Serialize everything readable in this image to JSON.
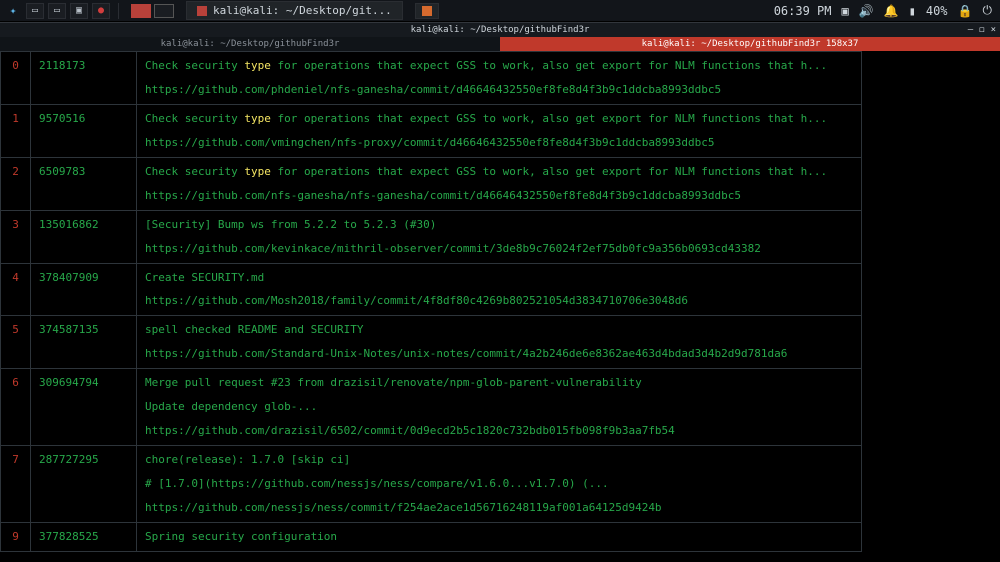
{
  "panel": {
    "clock": "06:39 PM",
    "battery": "40%",
    "task_label": "kali@kali: ~/Desktop/git..."
  },
  "window": {
    "title": "kali@kali: ~/Desktop/githubFind3r",
    "tabs": [
      {
        "label": "kali@kali: ~/Desktop/githubFind3r"
      },
      {
        "label": "kali@kali: ~/Desktop/githubFind3r 158x37"
      }
    ],
    "active_tab": 1
  },
  "results": [
    {
      "idx": "0",
      "hash": "2118173",
      "msg": "Check security type for operations that expect GSS to work, also get export for NLM functions that h...",
      "url": "https://github.com/phdeniel/nfs-ganesha/commit/d46646432550ef8fe8d4f3b9c1ddcba8993ddbc5"
    },
    {
      "idx": "1",
      "hash": "9570516",
      "msg": "Check security type for operations that expect GSS to work, also get export for NLM functions that h...",
      "url": "https://github.com/vmingchen/nfs-proxy/commit/d46646432550ef8fe8d4f3b9c1ddcba8993ddbc5"
    },
    {
      "idx": "2",
      "hash": "6509783",
      "msg": "Check security type for operations that expect GSS to work, also get export for NLM functions that h...",
      "url": "https://github.com/nfs-ganesha/nfs-ganesha/commit/d46646432550ef8fe8d4f3b9c1ddcba8993ddbc5"
    },
    {
      "idx": "3",
      "hash": "135016862",
      "msg": "[Security] Bump ws from 5.2.2 to 5.2.3 (#30)",
      "url": "https://github.com/kevinkace/mithril-observer/commit/3de8b9c76024f2ef75db0fc9a356b0693cd43382"
    },
    {
      "idx": "4",
      "hash": "378407909",
      "msg": "Create SECURITY.md",
      "url": "https://github.com/Mosh2018/family/commit/4f8df80c4269b802521054d3834710706e3048d6"
    },
    {
      "idx": "5",
      "hash": "374587135",
      "msg": "spell checked README and SECURITY",
      "url": "https://github.com/Standard-Unix-Notes/unix-notes/commit/4a2b246de6e8362ae463d4bdad3d4b2d9d781da6"
    },
    {
      "idx": "6",
      "hash": "309694794",
      "msg": "Merge pull request #23 from drazisil/renovate/npm-glob-parent-vulnerability",
      "msg2": "Update dependency glob-...",
      "url": "https://github.com/drazisil/6502/commit/0d9ecd2b5c1820c732bdb015fb098f9b3aa7fb54"
    },
    {
      "idx": "7",
      "hash": "287727295",
      "msg": "chore(release): 1.7.0 [skip ci]",
      "msg2": "# [1.7.0](https://github.com/nessjs/ness/compare/v1.6.0...v1.7.0) (...",
      "url": "https://github.com/nessjs/ness/commit/f254ae2ace1d56716248119af001a64125d9424b"
    },
    {
      "idx": "9",
      "hash": "377828525",
      "msg": "Spring security configuration"
    }
  ],
  "highlight_word": "type"
}
